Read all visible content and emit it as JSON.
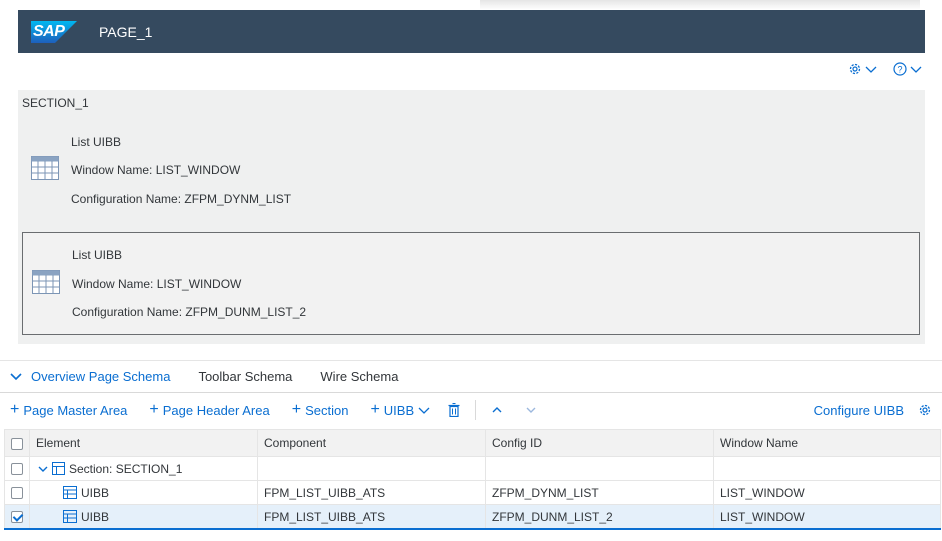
{
  "shell": {
    "logo": "SAP",
    "page_title": "PAGE_1"
  },
  "options": {
    "settings_icon": "gear-icon",
    "help_icon": "help-icon"
  },
  "section": {
    "title": "SECTION_1",
    "uibbs": [
      {
        "type": "List UIBB",
        "window": "Window Name: LIST_WINDOW",
        "config": "Configuration Name: ZFPM_DYNM_LIST",
        "selected": false
      },
      {
        "type": "List UIBB",
        "window": "Window Name: LIST_WINDOW",
        "config": "Configuration Name: ZFPM_DUNM_LIST_2",
        "selected": true
      }
    ]
  },
  "tabs": [
    "Overview Page Schema",
    "Toolbar Schema",
    "Wire Schema"
  ],
  "toolbar": {
    "page_master_area": "Page Master Area",
    "page_header_area": "Page Header Area",
    "section": "Section",
    "uibb": "UIBB",
    "configure_uibb": "Configure UIBB"
  },
  "table": {
    "headers": [
      "Element",
      "Component",
      "Config ID",
      "Window Name"
    ],
    "rows": [
      {
        "element": "Section: SECTION_1",
        "component": "",
        "config_id": "",
        "window": "",
        "checked": false,
        "level": 0
      },
      {
        "element": "UIBB",
        "component": "FPM_LIST_UIBB_ATS",
        "config_id": "ZFPM_DYNM_LIST",
        "window": "LIST_WINDOW",
        "checked": false,
        "level": 1
      },
      {
        "element": "UIBB",
        "component": "FPM_LIST_UIBB_ATS",
        "config_id": "ZFPM_DUNM_LIST_2",
        "window": "LIST_WINDOW",
        "checked": true,
        "level": 1
      }
    ]
  },
  "colors": {
    "shell": "#354a5f",
    "accent": "#0a6ed1",
    "section_bg": "#eff0f0"
  }
}
